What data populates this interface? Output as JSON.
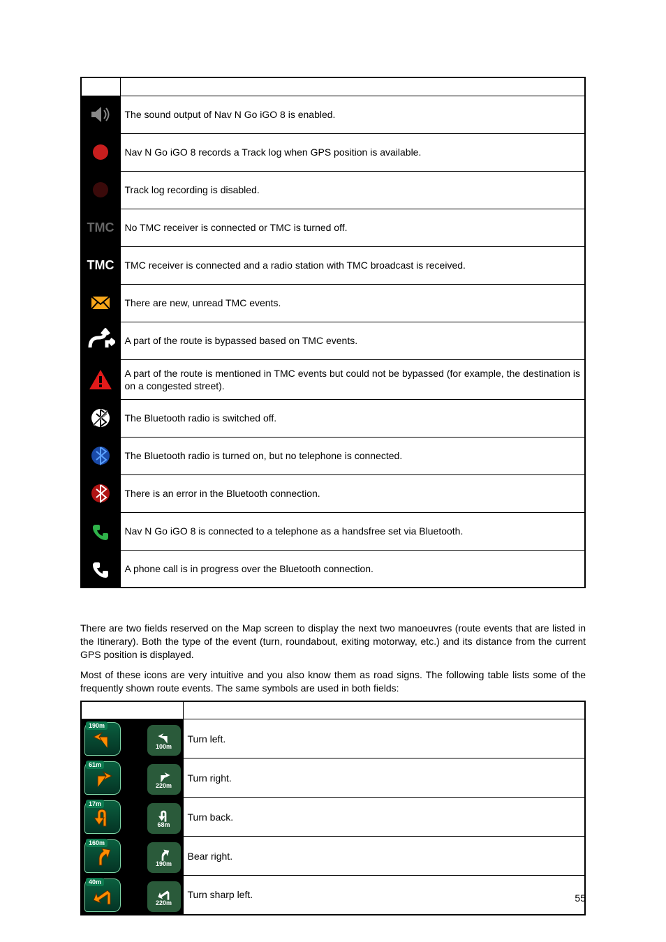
{
  "table1": {
    "rows": [
      {
        "icon": "sound-enabled",
        "desc": "The sound output of Nav N Go iGO 8 is enabled."
      },
      {
        "icon": "tracklog-enabled",
        "desc": "Nav N Go iGO 8 records a Track log when GPS position is available."
      },
      {
        "icon": "tracklog-disabled",
        "desc": "Track log recording is disabled."
      },
      {
        "icon": "tmc-off",
        "desc": "No TMC receiver is connected or TMC is turned off."
      },
      {
        "icon": "tmc-on",
        "desc": "TMC receiver is connected and a radio station with TMC broadcast is received."
      },
      {
        "icon": "tmc-unread",
        "desc": "There are new, unread TMC events."
      },
      {
        "icon": "tmc-bypass",
        "desc": "A part of the route is bypassed based on TMC events."
      },
      {
        "icon": "tmc-warning",
        "desc": "A part of the route is mentioned in TMC events but could not be bypassed (for example, the destination is on a congested street)."
      },
      {
        "icon": "bt-off",
        "desc": "The Bluetooth radio is switched off."
      },
      {
        "icon": "bt-on-noconn",
        "desc": "The Bluetooth radio is turned on, but no telephone is connected."
      },
      {
        "icon": "bt-error",
        "desc": "There is an error in the Bluetooth connection."
      },
      {
        "icon": "bt-handsfree",
        "desc": "Nav N Go iGO 8 is connected to a telephone as a handsfree set via Bluetooth."
      },
      {
        "icon": "bt-call",
        "desc": "A phone call is in progress over the Bluetooth connection."
      }
    ]
  },
  "paragraph1": "There are two fields reserved on the Map screen to display the next two manoeuvres (route events that are listed in the Itinerary). Both the type of the event (turn, roundabout, exiting motorway, etc.) and its distance from the current GPS position is displayed.",
  "paragraph2": "Most of these icons are very intuitive and you also know them as road signs. The following table lists some of the frequently shown route events. The same symbols are used in both fields:",
  "table2": {
    "rows": [
      {
        "primary_dist": "190m",
        "secondary_dist": "100m",
        "desc": "Turn left."
      },
      {
        "primary_dist": "61m",
        "secondary_dist": "220m",
        "desc": "Turn right."
      },
      {
        "primary_dist": "17m",
        "secondary_dist": "68m",
        "desc": "Turn back."
      },
      {
        "primary_dist": "160m",
        "secondary_dist": "190m",
        "desc": "Bear right."
      },
      {
        "primary_dist": "40m",
        "secondary_dist": "220m",
        "desc": "Turn sharp left."
      }
    ]
  },
  "page_number": "55"
}
